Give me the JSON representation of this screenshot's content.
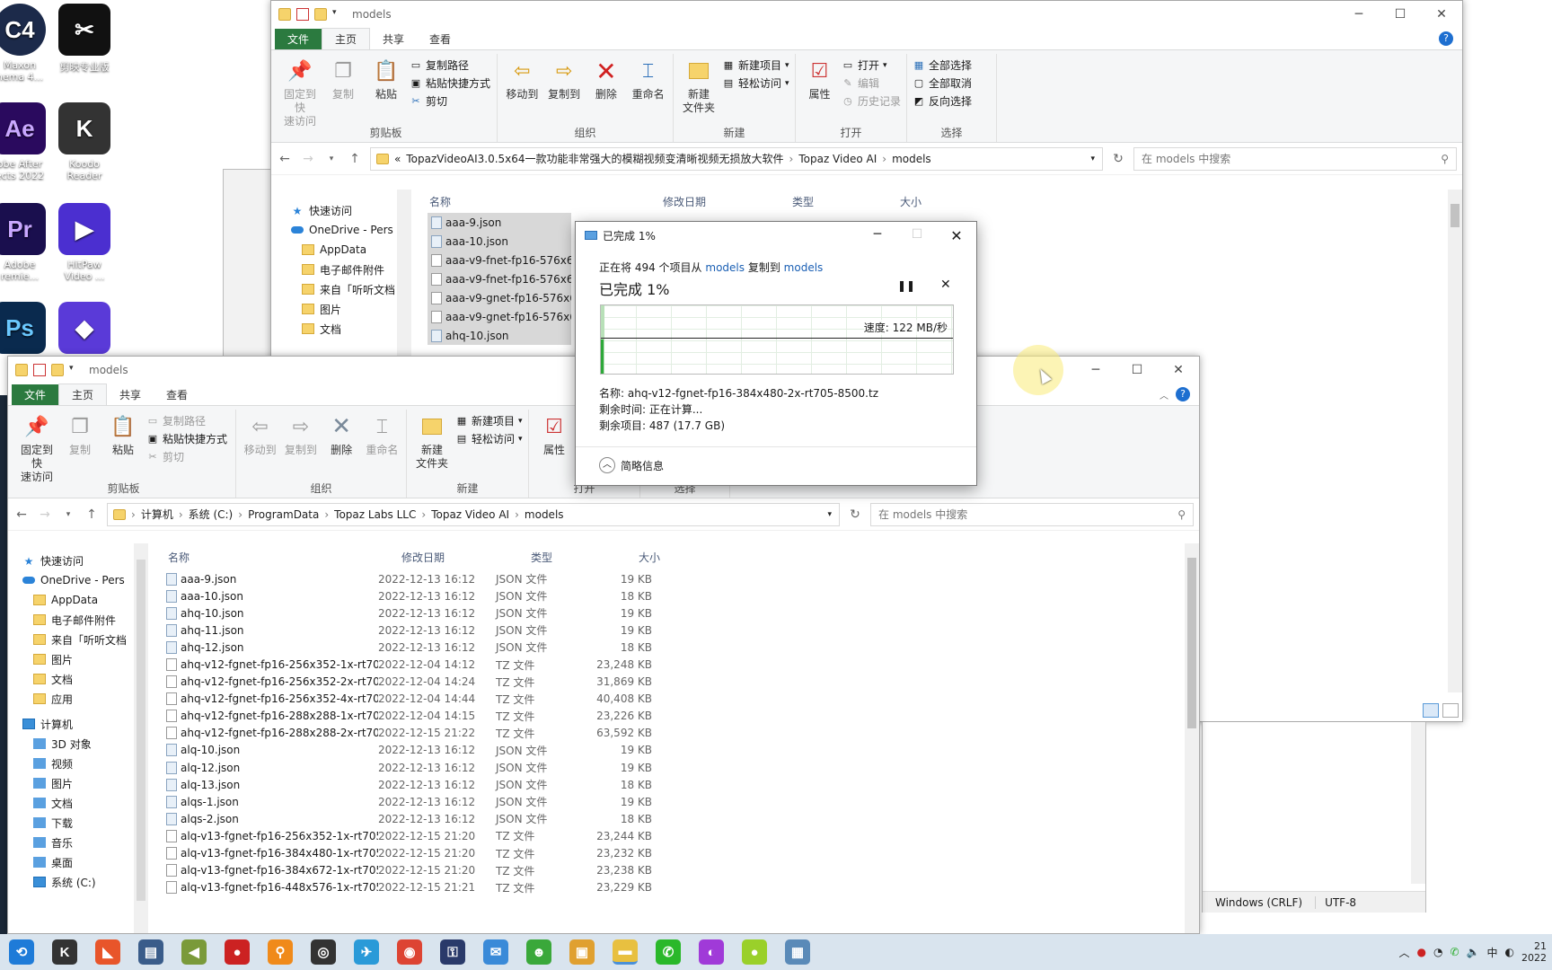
{
  "desktop": {
    "icons": [
      {
        "label": "Maxon\nnema 4...",
        "glyph": "C4",
        "color": "#1c2a4a"
      },
      {
        "label": "剪映专业版",
        "glyph": "✂",
        "color": "#111111"
      },
      {
        "label": "obe After\nects 2022",
        "glyph": "Ae",
        "color": "#2a0a5e"
      },
      {
        "label": "Koodo\nReader",
        "glyph": "K",
        "color": "#333333"
      },
      {
        "label": "Adobe\nremie...",
        "glyph": "Pr",
        "color": "#1a0f4e"
      },
      {
        "label": "HitPaw\nVideo ...",
        "glyph": "▶",
        "color": "#4b2fd0"
      },
      {
        "label": "",
        "glyph": "Ps",
        "color": "#0a2a4e"
      },
      {
        "label": "",
        "glyph": "◆",
        "color": "#5a3ad8"
      }
    ]
  },
  "back_window": {
    "title": "models",
    "tabs": [
      "文件",
      "主页",
      "共享",
      "查看"
    ],
    "clipboard": {
      "pin": "固定到快\n速访问",
      "copy": "复制",
      "paste": "粘贴",
      "copy_path": "复制路径",
      "paste_shortcut": "粘贴快捷方式",
      "cut": "剪切",
      "label": "剪贴板"
    },
    "organize": {
      "move_to": "移动到",
      "copy_to": "复制到",
      "delete": "删除",
      "rename": "重命名",
      "label": "组织"
    },
    "new": {
      "new_folder": "新建\n文件夹",
      "new_item": "新建项目",
      "easy_access": "轻松访问",
      "label": "新建"
    },
    "open": {
      "properties": "属性",
      "open": "打开",
      "edit": "编辑",
      "history": "历史记录",
      "label": "打开"
    },
    "select": {
      "all": "全部选择",
      "none": "全部取消",
      "invert": "反向选择",
      "label": "选择"
    },
    "address": [
      "«",
      "TopazVideoAI3.0.5x64一款功能非常强大的模糊视频变清晰视频无损放大软件",
      "Topaz Video AI",
      "models"
    ],
    "search_placeholder": "在 models 中搜索",
    "nav": [
      "快速访问",
      "OneDrive - Pers",
      "AppData",
      "电子邮件附件",
      "来自「听听文档",
      "图片",
      "文档"
    ],
    "columns": [
      "名称",
      "修改日期",
      "类型",
      "大小"
    ],
    "files": [
      "aaa-9.json",
      "aaa-10.json",
      "aaa-v9-fnet-fp16-576x67",
      "aaa-v9-fnet-fp16-576x67",
      "aaa-v9-gnet-fp16-576x6",
      "aaa-v9-gnet-fp16-576x6",
      "ahq-10.json"
    ],
    "status": {
      "line_ending": "Windows (CRLF)",
      "encoding": "UTF-8"
    }
  },
  "front_window": {
    "title": "models",
    "tabs": [
      "文件",
      "主页",
      "共享",
      "查看"
    ],
    "clipboard": {
      "pin": "固定到快\n速访问",
      "copy": "复制",
      "paste": "粘贴",
      "copy_path": "复制路径",
      "paste_shortcut": "粘贴快捷方式",
      "cut": "剪切",
      "label": "剪贴板"
    },
    "organize": {
      "move_to": "移动到",
      "copy_to": "复制到",
      "delete": "删除",
      "rename": "重命名",
      "label": "组织"
    },
    "new": {
      "new_folder": "新建\n文件夹",
      "new_item": "新建项目",
      "easy_access": "轻松访问",
      "label": "新建"
    },
    "open": {
      "properties": "属性",
      "label": "打开"
    },
    "select": {
      "label": "选择"
    },
    "address": [
      "计算机",
      "系统 (C:)",
      "ProgramData",
      "Topaz Labs LLC",
      "Topaz Video AI",
      "models"
    ],
    "search_placeholder": "在 models 中搜索",
    "nav": [
      {
        "label": "快速访问",
        "icon": "star"
      },
      {
        "label": "OneDrive - Pers",
        "icon": "cloud"
      },
      {
        "label": "AppData",
        "icon": "folder"
      },
      {
        "label": "电子邮件附件",
        "icon": "folder"
      },
      {
        "label": "来自「听听文档",
        "icon": "folder"
      },
      {
        "label": "图片",
        "icon": "folder"
      },
      {
        "label": "文档",
        "icon": "folder"
      },
      {
        "label": "应用",
        "icon": "folder"
      },
      {
        "label": "计算机",
        "icon": "pc"
      },
      {
        "label": "3D 对象",
        "icon": "blue"
      },
      {
        "label": "视频",
        "icon": "blue"
      },
      {
        "label": "图片",
        "icon": "blue"
      },
      {
        "label": "文档",
        "icon": "blue"
      },
      {
        "label": "下载",
        "icon": "blue"
      },
      {
        "label": "音乐",
        "icon": "blue"
      },
      {
        "label": "桌面",
        "icon": "blue"
      },
      {
        "label": "系统 (C:)",
        "icon": "pc"
      }
    ],
    "columns": [
      "名称",
      "修改日期",
      "类型",
      "大小"
    ],
    "files": [
      {
        "name": "aaa-9.json",
        "date": "2022-12-13 16:12",
        "type": "JSON 文件",
        "size": "19 KB",
        "kind": "json"
      },
      {
        "name": "aaa-10.json",
        "date": "2022-12-13 16:12",
        "type": "JSON 文件",
        "size": "18 KB",
        "kind": "json"
      },
      {
        "name": "ahq-10.json",
        "date": "2022-12-13 16:12",
        "type": "JSON 文件",
        "size": "19 KB",
        "kind": "json"
      },
      {
        "name": "ahq-11.json",
        "date": "2022-12-13 16:12",
        "type": "JSON 文件",
        "size": "19 KB",
        "kind": "json"
      },
      {
        "name": "ahq-12.json",
        "date": "2022-12-13 16:12",
        "type": "JSON 文件",
        "size": "18 KB",
        "kind": "json"
      },
      {
        "name": "ahq-v12-fgnet-fp16-256x352-1x-rt70...",
        "date": "2022-12-04 14:12",
        "type": "TZ 文件",
        "size": "23,248 KB",
        "kind": "tz"
      },
      {
        "name": "ahq-v12-fgnet-fp16-256x352-2x-rt70...",
        "date": "2022-12-04 14:24",
        "type": "TZ 文件",
        "size": "31,869 KB",
        "kind": "tz"
      },
      {
        "name": "ahq-v12-fgnet-fp16-256x352-4x-rt70...",
        "date": "2022-12-04 14:44",
        "type": "TZ 文件",
        "size": "40,408 KB",
        "kind": "tz"
      },
      {
        "name": "ahq-v12-fgnet-fp16-288x288-1x-rt70...",
        "date": "2022-12-04 14:15",
        "type": "TZ 文件",
        "size": "23,226 KB",
        "kind": "tz"
      },
      {
        "name": "ahq-v12-fgnet-fp16-288x288-2x-rt70...",
        "date": "2022-12-15 21:22",
        "type": "TZ 文件",
        "size": "63,592 KB",
        "kind": "tz"
      },
      {
        "name": "alq-10.json",
        "date": "2022-12-13 16:12",
        "type": "JSON 文件",
        "size": "19 KB",
        "kind": "json"
      },
      {
        "name": "alq-12.json",
        "date": "2022-12-13 16:12",
        "type": "JSON 文件",
        "size": "19 KB",
        "kind": "json"
      },
      {
        "name": "alq-13.json",
        "date": "2022-12-13 16:12",
        "type": "JSON 文件",
        "size": "18 KB",
        "kind": "json"
      },
      {
        "name": "alqs-1.json",
        "date": "2022-12-13 16:12",
        "type": "JSON 文件",
        "size": "19 KB",
        "kind": "json"
      },
      {
        "name": "alqs-2.json",
        "date": "2022-12-13 16:12",
        "type": "JSON 文件",
        "size": "18 KB",
        "kind": "json"
      },
      {
        "name": "alq-v13-fgnet-fp16-256x352-1x-rt705...",
        "date": "2022-12-15 21:20",
        "type": "TZ 文件",
        "size": "23,244 KB",
        "kind": "tz"
      },
      {
        "name": "alq-v13-fgnet-fp16-384x480-1x-rt705...",
        "date": "2022-12-15 21:20",
        "type": "TZ 文件",
        "size": "23,232 KB",
        "kind": "tz"
      },
      {
        "name": "alq-v13-fgnet-fp16-384x672-1x-rt705...",
        "date": "2022-12-15 21:20",
        "type": "TZ 文件",
        "size": "23,238 KB",
        "kind": "tz"
      },
      {
        "name": "alq-v13-fgnet-fp16-448x576-1x-rt705...",
        "date": "2022-12-15 21:21",
        "type": "TZ 文件",
        "size": "23,229 KB",
        "kind": "tz"
      }
    ]
  },
  "copy_dialog": {
    "title": "已完成 1%",
    "line_prefix": "正在将 494 个项目从",
    "source": "models",
    "line_mid": "复制到",
    "dest": "models",
    "percent_label": "已完成 1%",
    "progress": 0.01,
    "speed": "速度: 122 MB/秒",
    "name_label": "名称: ahq-v12-fgnet-fp16-384x480-2x-rt705-8500.tz",
    "time_label": "剩余时间: 正在计算...",
    "items_label": "剩余项目: 487 (17.7 GB)",
    "less_info": "简略信息"
  },
  "taskbar": {
    "apps": [
      {
        "glyph": "⟲",
        "color": "#1e7bd8"
      },
      {
        "glyph": "K",
        "color": "#333333"
      },
      {
        "glyph": "◣",
        "color": "#e8552a"
      },
      {
        "glyph": "▤",
        "color": "#3a5c8a"
      },
      {
        "glyph": "◀",
        "color": "#7a9a3a"
      },
      {
        "glyph": "●",
        "color": "#cc2222"
      },
      {
        "glyph": "⚲",
        "color": "#f08a1a"
      },
      {
        "glyph": "◎",
        "color": "#333333"
      },
      {
        "glyph": "✈",
        "color": "#2a9ad8"
      },
      {
        "glyph": "◉",
        "color": "#dd4433"
      },
      {
        "glyph": "⚿",
        "color": "#2a3a6a"
      },
      {
        "glyph": "✉",
        "color": "#3a8ad8"
      },
      {
        "glyph": "☻",
        "color": "#3aa83a"
      },
      {
        "glyph": "▣",
        "color": "#e0a030"
      },
      {
        "glyph": "▬",
        "color": "#e8c040"
      },
      {
        "glyph": "✆",
        "color": "#2ab82a"
      },
      {
        "glyph": "◐",
        "color": "#a03ad8"
      },
      {
        "glyph": "●",
        "color": "#9ad02a"
      },
      {
        "glyph": "▦",
        "color": "#5a8ab8"
      }
    ],
    "ime": "中",
    "clock_time": "21",
    "clock_date": "2022"
  }
}
